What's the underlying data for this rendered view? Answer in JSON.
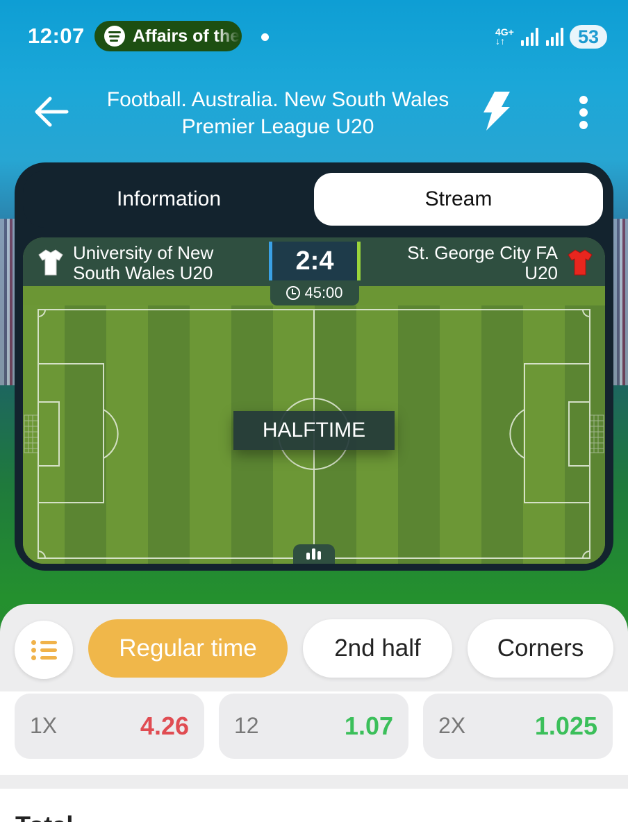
{
  "status_bar": {
    "time": "12:07",
    "media_text": "Affairs of the",
    "network": "4G+",
    "battery": "53"
  },
  "header": {
    "title": "Football. Australia. New South Wales Premier League U20"
  },
  "tabs": {
    "information": "Information",
    "stream": "Stream"
  },
  "match": {
    "home_team": "University of New South Wales U20",
    "away_team": "St. George City FA U20",
    "score": "2:4",
    "clock": "45:00",
    "state": "HALFTIME",
    "home_kit_color": "#ffffff",
    "away_kit_color": "#e8261e"
  },
  "markets": {
    "chips": [
      "Regular time",
      "2nd half",
      "Corners"
    ]
  },
  "odds": [
    {
      "label": "1X",
      "value": "4.26",
      "color": "#e04c52"
    },
    {
      "label": "12",
      "value": "1.07",
      "color": "#3bbf5a"
    },
    {
      "label": "2X",
      "value": "1.025",
      "color": "#3bbf5a"
    }
  ],
  "next_section": {
    "title": "Total"
  },
  "colors": {
    "accent": "#f0b74a",
    "scoreboard": "#2f4f40"
  }
}
